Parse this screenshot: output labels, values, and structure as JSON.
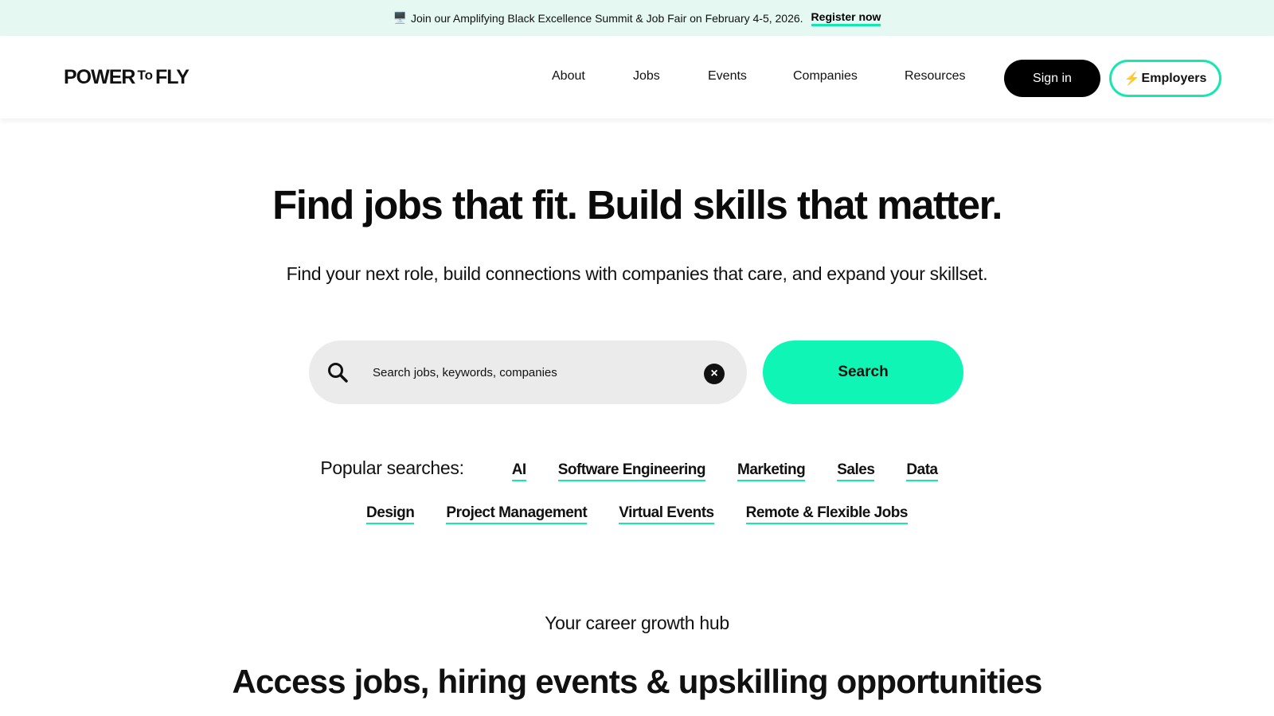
{
  "banner": {
    "icon": "monitor-icon",
    "text": "Join our Amplifying Black Excellence Summit & Job Fair on February 4-5, 2026.",
    "link_label": "Register now",
    "bg_color": "#e6f8f2",
    "accent_color": "#14e8b0"
  },
  "header": {
    "logo": {
      "part1": "POWER",
      "part2": "To",
      "part3": "FLY"
    },
    "nav": [
      "About",
      "Jobs",
      "Events",
      "Companies",
      "Resources"
    ],
    "signin_label": "Sign in",
    "employers_label": "Employers",
    "employers_icon": "lightning-bolt-icon"
  },
  "hero": {
    "title": "Find jobs that fit. Build skills that matter.",
    "subtitle": "Find your next role, build connections with companies that care, and expand your skillset."
  },
  "search": {
    "placeholder": "Search jobs, keywords, companies",
    "value": "",
    "button_label": "Search",
    "button_color": "#0ef5b5"
  },
  "popular": {
    "label": "Popular searches:",
    "row1": [
      "AI",
      "Software Engineering",
      "Marketing",
      "Sales",
      "Data"
    ],
    "row2": [
      "Design",
      "Project Management",
      "Virtual Events",
      "Remote & Flexible Jobs"
    ]
  },
  "hub": {
    "label": "Your career growth hub",
    "title": "Access jobs, hiring events & upskilling opportunities"
  }
}
